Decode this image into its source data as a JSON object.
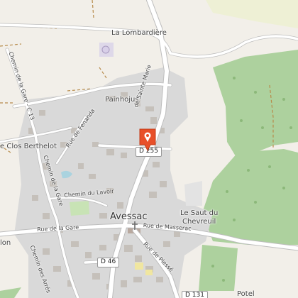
{
  "map": {
    "colors": {
      "background": "#f2efe9",
      "urban": "#d9d9d9",
      "building": "#c5c0ba",
      "forest": "#add19e",
      "road": "#ffffff",
      "road_outline": "#bdbdbd",
      "marker": "#e8502a",
      "track": "#b78b4b"
    },
    "places": {
      "lombardiere": "La Lombardière",
      "painhojus": "Painhojus",
      "clos_berthelot": "e Clos Berthelot",
      "avessac": "Avessac",
      "saut_chevreuil": "Le Saut du\nChevreuil",
      "potel": "Potel",
      "lon": "lon"
    },
    "streets": {
      "sainte_marie": "de Sainte Marie",
      "chemin_gare_c13": "Chemin de la Gare - C 13",
      "rue_fenanda": "Rue de Fenanda",
      "chemin_gare_left": "Chemin de la Gare",
      "chemin_lavoir": "Chemin du Lavoir",
      "rue_gare": "Rue de la Gare",
      "rue_masserac": "Rue de Masserac",
      "rue_plesse": "Rue de Plessé",
      "chemin_arres": "Chemin des Arrés"
    },
    "shields": {
      "d255": "D 255",
      "d46": "D 46",
      "d131": "D 131"
    },
    "marker_icon": "location-pin-icon",
    "church_icon": "church-icon"
  }
}
